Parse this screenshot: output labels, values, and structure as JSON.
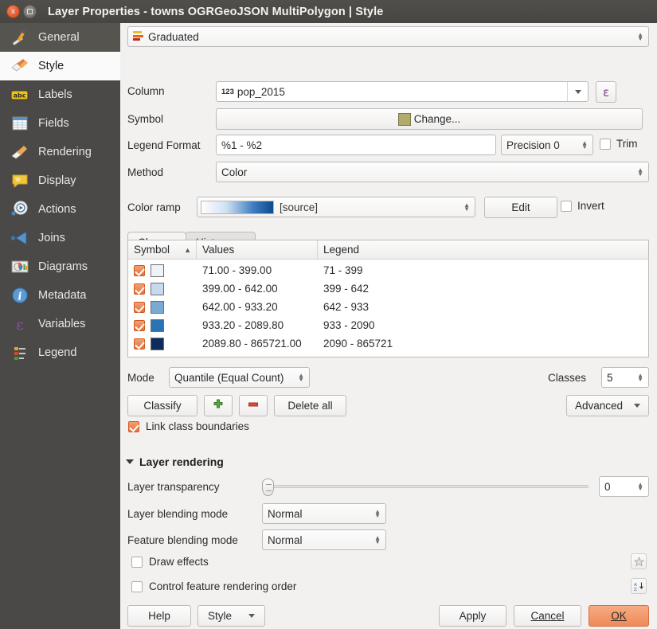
{
  "window": {
    "title": "Layer Properties - towns OGRGeoJSON MultiPolygon | Style",
    "close_icon": "close-icon",
    "maximize_icon": "maximize-icon"
  },
  "sidebar": {
    "items": [
      {
        "label": "General",
        "icon": "hammer-wrench-icon",
        "selected": false
      },
      {
        "label": "Style",
        "icon": "paintbrush-icon",
        "selected": true
      },
      {
        "label": "Labels",
        "icon": "abc-label-icon",
        "selected": false
      },
      {
        "label": "Fields",
        "icon": "table-grid-icon",
        "selected": false
      },
      {
        "label": "Rendering",
        "icon": "brush-icon",
        "selected": false
      },
      {
        "label": "Display",
        "icon": "speech-bubble-icon",
        "selected": false
      },
      {
        "label": "Actions",
        "icon": "gear-play-icon",
        "selected": false
      },
      {
        "label": "Joins",
        "icon": "join-arrow-icon",
        "selected": false
      },
      {
        "label": "Diagrams",
        "icon": "pie-chart-icon",
        "selected": false
      },
      {
        "label": "Metadata",
        "icon": "info-circle-icon",
        "selected": false
      },
      {
        "label": "Variables",
        "icon": "epsilon-icon",
        "selected": false
      },
      {
        "label": "Legend",
        "icon": "legend-list-icon",
        "selected": false
      }
    ]
  },
  "style": {
    "renderer": {
      "value": "Graduated",
      "icon": "graduated-bars-icon"
    },
    "column": {
      "label": "Column",
      "value": "pop_2015",
      "type_icon": "123-numeric-icon",
      "expression_button": "ε"
    },
    "symbol": {
      "label": "Symbol",
      "button_label": "Change...",
      "swatch_color": "#b0ab6b"
    },
    "legend_format": {
      "label": "Legend Format",
      "value": "%1 - %2",
      "precision_label": "Precision 0",
      "trim_label": "Trim",
      "trim_checked": false
    },
    "method": {
      "label": "Method",
      "value": "Color"
    },
    "color_ramp": {
      "label": "Color ramp",
      "value": "[source]",
      "ramp_start": "#ffffff",
      "ramp_end": "#0b4a8f",
      "edit_label": "Edit",
      "invert_label": "Invert",
      "invert_checked": false
    },
    "tabs": [
      {
        "label": "Classes",
        "selected": true
      },
      {
        "label": "Histogram",
        "selected": false
      }
    ],
    "table": {
      "headers": [
        "Symbol",
        "Values",
        "Legend"
      ],
      "sort_indicator": "▲",
      "rows": [
        {
          "checked": true,
          "color": "#eef3f9",
          "values": "71.00 - 399.00",
          "legend": "71 - 399"
        },
        {
          "checked": true,
          "color": "#c6d9ef",
          "values": "399.00 - 642.00",
          "legend": "399 - 642"
        },
        {
          "checked": true,
          "color": "#7aa9d4",
          "values": "642.00 - 933.20",
          "legend": "642 - 933"
        },
        {
          "checked": true,
          "color": "#2a74b6",
          "values": "933.20 - 2089.80",
          "legend": "933 - 2090"
        },
        {
          "checked": true,
          "color": "#0d2c5c",
          "values": "2089.80 - 865721.00",
          "legend": "2090 - 865721"
        }
      ]
    },
    "mode": {
      "label": "Mode",
      "value": "Quantile (Equal Count)"
    },
    "classes_count": {
      "label": "Classes",
      "value": "5"
    },
    "buttons": {
      "classify": "Classify",
      "add_icon": "plus-icon",
      "remove_icon": "minus-icon",
      "delete_all": "Delete all",
      "advanced": "Advanced"
    },
    "link_class_boundaries": {
      "label": "Link class boundaries",
      "checked": true
    }
  },
  "layer_rendering": {
    "title": "Layer rendering",
    "expanded": true,
    "transparency": {
      "label": "Layer transparency",
      "value": "0",
      "min": 0,
      "max": 100
    },
    "layer_blending": {
      "label": "Layer blending mode",
      "value": "Normal"
    },
    "feature_blending": {
      "label": "Feature blending mode",
      "value": "Normal"
    },
    "draw_effects": {
      "label": "Draw effects",
      "checked": false,
      "side_icon": "effects-star-icon"
    },
    "control_order": {
      "label": "Control feature rendering order",
      "checked": false,
      "side_icon": "sort-az-icon"
    }
  },
  "footer": {
    "help": "Help",
    "style_menu": "Style",
    "apply": "Apply",
    "cancel": "Cancel",
    "ok": "OK"
  }
}
